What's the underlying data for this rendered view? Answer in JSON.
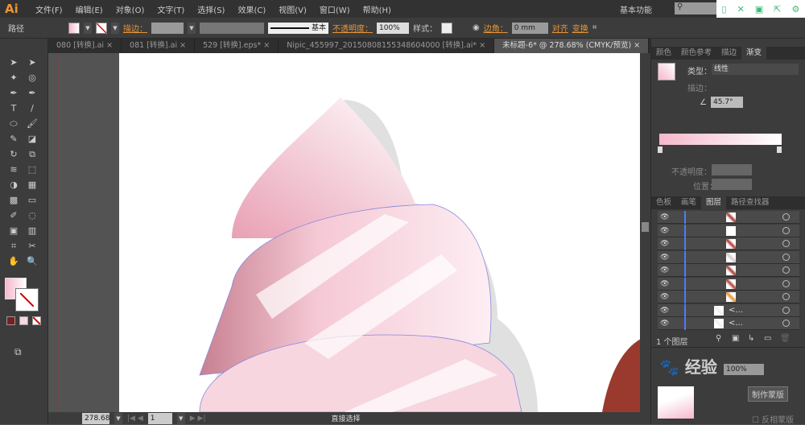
{
  "app": {
    "logo": "Ai",
    "menus": [
      "文件(F)",
      "编辑(E)",
      "对象(O)",
      "文字(T)",
      "选择(S)",
      "效果(C)",
      "视图(V)",
      "窗口(W)",
      "帮助(H)"
    ],
    "workspace": "基本功能"
  },
  "control": {
    "object_type": "路径",
    "stroke_label": "描边：",
    "stroke_style": "基本",
    "opacity_label": "不透明度：",
    "opacity": "100%",
    "style_label": "样式：",
    "corner_label": "边角：",
    "corner_value": "0 mm",
    "align": "对齐",
    "transform": "变换"
  },
  "tabs": [
    {
      "label": "080 [转换].ai"
    },
    {
      "label": "081 [转换].ai"
    },
    {
      "label": "529 [转换].eps*"
    },
    {
      "label": "Nipic_455997_20150808155348604000 [转换].ai*"
    },
    {
      "label": "未标题-6* @ 278.68% (CMYK/预览)",
      "active": true
    }
  ],
  "gradient_panel": {
    "tabs": [
      "颜色",
      "颜色参考",
      "描边",
      "渐变"
    ],
    "active": "渐变",
    "type_label": "类型：",
    "type": "线性",
    "stroke_label": "描边：",
    "angle": "45.7°",
    "opacity_label": "不透明度：",
    "position_label": "位置：",
    "colors": {
      "start": "#f5b8cb",
      "end": "#ffffff"
    }
  },
  "layers_panel": {
    "tabs": [
      "色板",
      "画笔",
      "图层",
      "路径查找器"
    ],
    "active": "图层",
    "rows": [
      {
        "thumb": "#a33a30"
      },
      {
        "thumb": "#ffffff"
      },
      {
        "thumb": "#b03a30"
      },
      {
        "thumb": "#d8c8c8"
      },
      {
        "thumb": "#a33a30"
      },
      {
        "thumb": "#b04030"
      },
      {
        "thumb": "#e89030"
      },
      {
        "thumb": "#eeeeee",
        "label": "<..."
      },
      {
        "thumb": "#eeeeee",
        "label": "<..."
      }
    ],
    "count": "1 个图层"
  },
  "transparency_panel": {
    "opacity": "100%",
    "make_mask": "制作蒙版",
    "invert_mask": "反相蒙版"
  },
  "status": {
    "zoom": "278.68",
    "page": "1",
    "tool": "直接选择"
  },
  "watermark": "Baidu 经验"
}
